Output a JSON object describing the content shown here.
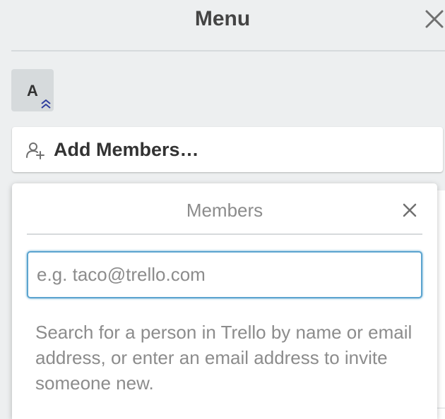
{
  "header": {
    "title": "Menu",
    "close_icon": "close-icon"
  },
  "members": {
    "avatar_initial": "A",
    "admin_badge_icon": "double-chevron-up-icon"
  },
  "add_members": {
    "label": "Add Members…",
    "icon": "add-person-icon"
  },
  "popover": {
    "title": "Members",
    "close_icon": "close-icon",
    "search_placeholder": "e.g. taco@trello.com",
    "search_value": "",
    "help_text": "Search for a person in Trello by name or email address, or enter an email address to invite someone new."
  },
  "colors": {
    "background": "#edeff0",
    "focus_ring": "#5ba4cf",
    "admin_badge": "#2e3e9e"
  }
}
